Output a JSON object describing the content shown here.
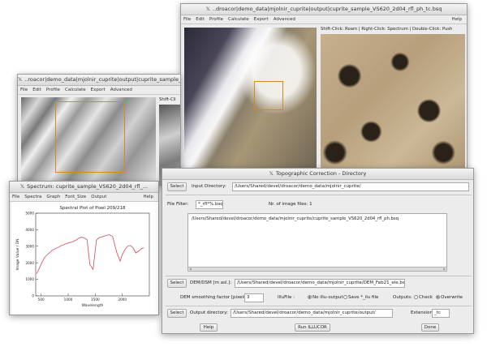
{
  "windows": {
    "main_image": {
      "title": "..droacor|demo_data|mjolnir_cuprite|output|cuprite_sample_VS620_2d04_rfl_ph_tc.bsq",
      "menu": [
        "File",
        "Edit",
        "Profile",
        "Calculate",
        "Export",
        "Advanced"
      ],
      "help": "Help",
      "hint": "Shift-Click: Roam | Right-Click: Spectrum | Double-Click: Push"
    },
    "dem_image": {
      "title": "..roacor|demo_data|mjolnir_cuprite|output|cuprite_sample_VS620_...",
      "menu": [
        "File",
        "Edit",
        "Profile",
        "Calculate",
        "Export",
        "Advanced"
      ],
      "hint": "Shift-Cli"
    },
    "spectrum": {
      "title": "Spectrum: cuprite_sample_VS620_2d04_rfl_...",
      "menu": [
        "File",
        "Spectra",
        "Graph",
        "Font_Size",
        "Output"
      ],
      "help": "Help"
    },
    "topo": {
      "title": "Topographic Correction - Directory",
      "select_label": "Select",
      "input_dir_label": "Input Directory:",
      "input_dir_value": "/Users/Shared/devel/droacor/demo_data/mjolnir_cuprite/",
      "file_filter_label": "File Filter:",
      "file_filter_value": "*_rfl*%.bsq",
      "num_files_label": "Nr. of image files: 1",
      "file_list": [
        "/Users/Shared/devel/droacor/demo_data/mjolnir_cuprite/cuprite_sample_VS620_2d04_rfl_ph.bsq"
      ],
      "dem_select": "Select",
      "dem_label": "DEM/DSM [m asl.]:",
      "dem_value": "/Users/Shared/devel/droacor/demo_data/mjolnir_cuprite/DEM_Feb21_ele.bsq",
      "smoothing_label": "DEM smoothing factor [pixels]:",
      "smoothing_value": "3",
      "illu_label": "IlluFile :",
      "illu_opt1": "No illu-output",
      "illu_opt2": "Save *_ilu file",
      "outputs_label": "Outputs:",
      "outputs_opt1": "Check",
      "outputs_opt2": "Overwrite",
      "out_select": "Select",
      "out_dir_label": "Output directory:",
      "out_dir_value": "/Users/Shared/devel/droacor/demo_data/mjolnir_cuprite/output/",
      "extension_label": "Extension:",
      "extension_value": "_tc",
      "help_button": "Help",
      "run_button": "Run ILLUCOR",
      "done_button": "Done"
    }
  },
  "chart_data": {
    "type": "line",
    "title": "Spectral Plot of Pixel 209/218",
    "xlabel": "Wavelength",
    "ylabel": "Image Value / DN",
    "xlim": [
      400,
      2500
    ],
    "ylim": [
      0,
      5000
    ],
    "xticks": [
      500,
      1000,
      1500,
      2000
    ],
    "yticks": [
      0,
      1000,
      2000,
      3000,
      4000,
      5000
    ],
    "series": [
      {
        "color": "#d24a5a",
        "x": [
          420,
          470,
          520,
          560,
          600,
          650,
          700,
          760,
          820,
          880,
          920,
          960,
          1000,
          1060,
          1100,
          1160,
          1200,
          1250,
          1300,
          1350,
          1400,
          1460,
          1520,
          1560,
          1600,
          1650,
          1700,
          1760,
          1820,
          1900,
          1960,
          2000,
          2050,
          2100,
          2150,
          2200,
          2250,
          2300,
          2350,
          2400
        ],
        "y": [
          1350,
          1700,
          2050,
          2300,
          2450,
          2600,
          2750,
          2850,
          2950,
          3050,
          3100,
          3150,
          3200,
          3250,
          3300,
          3400,
          3500,
          3550,
          3500,
          3400,
          1900,
          1600,
          3350,
          3500,
          3550,
          3600,
          3650,
          3700,
          3600,
          2600,
          2100,
          2500,
          2800,
          3000,
          3050,
          2900,
          2600,
          2700,
          2850,
          2900
        ]
      }
    ],
    "grid": false
  }
}
